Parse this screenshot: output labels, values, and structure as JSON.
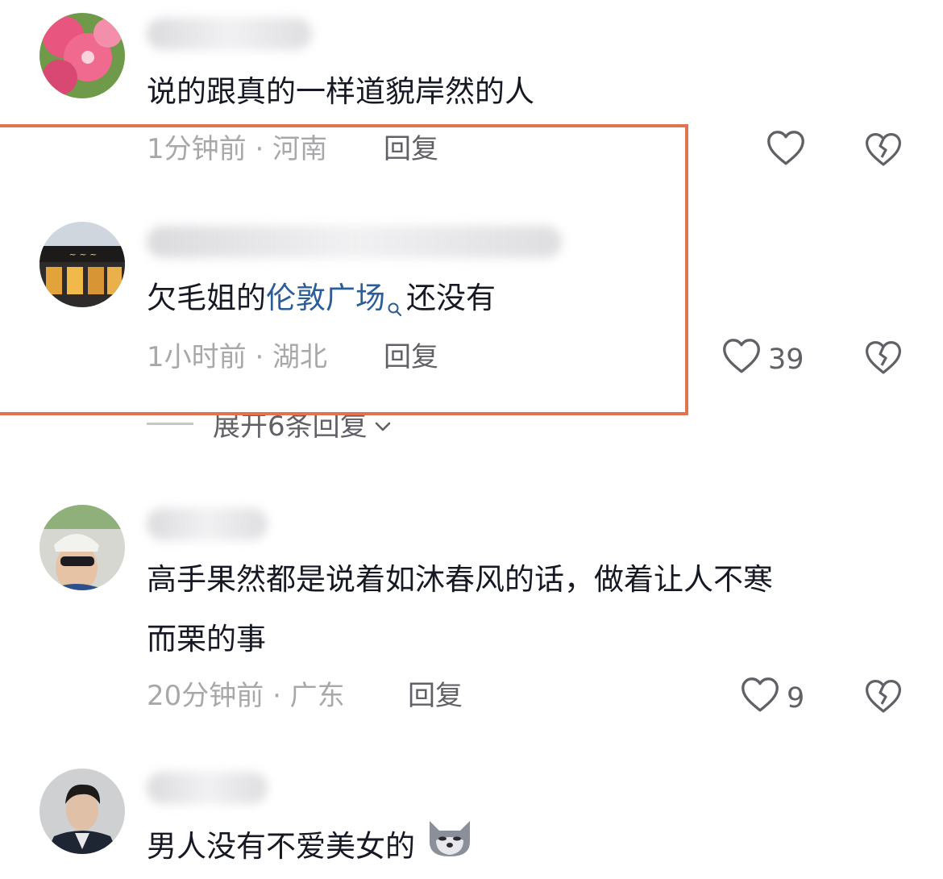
{
  "comments": [
    {
      "text": "说的跟真的一样道貌岸然的人",
      "time": "1分钟前 · 河南",
      "reply": "回复",
      "likes": ""
    },
    {
      "text_before": "欠毛姐的",
      "text_link": "伦敦广场",
      "text_after": "还没有",
      "time": "1小时前 · 湖北",
      "reply": "回复",
      "likes": "39",
      "expand": "展开6条回复"
    },
    {
      "text_line1": "高手果然都是说着如沐春风的话，做着让人不寒",
      "text_line2": "而栗的事",
      "time": "20分钟前 · 广东",
      "reply": "回复",
      "likes": "9"
    },
    {
      "text": "男人没有不爱美女的"
    }
  ],
  "colors": {
    "highlight_border": "#e2734e",
    "link": "#2b5d98",
    "meta": "#a8a8ab"
  },
  "icons": [
    "heart-icon",
    "broken-heart-icon",
    "search-mini-icon",
    "wolf-emoji-icon",
    "chevron-down-icon"
  ]
}
